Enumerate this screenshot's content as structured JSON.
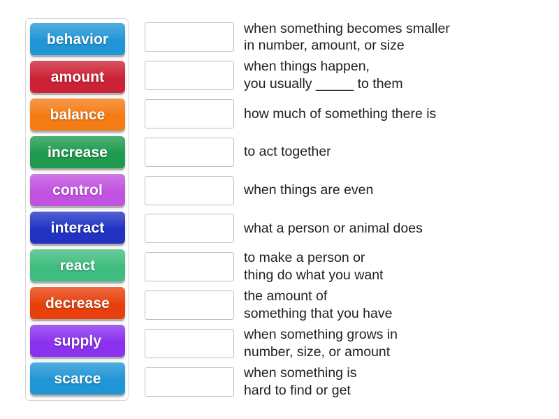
{
  "activity": {
    "type": "match-up",
    "tile_text_color": "#ffffff"
  },
  "tiles": [
    {
      "label": "behavior",
      "color": "#2196d6"
    },
    {
      "label": "amount",
      "color": "#cc2235"
    },
    {
      "label": "balance",
      "color": "#f57b14"
    },
    {
      "label": "increase",
      "color": "#1f9a4f"
    },
    {
      "label": "control",
      "color": "#c252e0"
    },
    {
      "label": "interact",
      "color": "#2233c4"
    },
    {
      "label": "react",
      "color": "#3fbd7f"
    },
    {
      "label": "decrease",
      "color": "#e8400c"
    },
    {
      "label": "supply",
      "color": "#8a32ee"
    },
    {
      "label": "scarce",
      "color": "#2196d6"
    }
  ],
  "definitions": [
    {
      "text": "when something becomes smaller\nin number, amount, or size"
    },
    {
      "text": "when things happen,\nyou usually _____ to them"
    },
    {
      "text": "how much of something there is"
    },
    {
      "text": "to act together"
    },
    {
      "text": "when things are even"
    },
    {
      "text": "what a person or animal does"
    },
    {
      "text": "to make a person or\nthing do what you want"
    },
    {
      "text": "the amount of\nsomething that you have"
    },
    {
      "text": "when something grows in\nnumber, size, or amount"
    },
    {
      "text": "when something is\nhard to find or get"
    }
  ]
}
